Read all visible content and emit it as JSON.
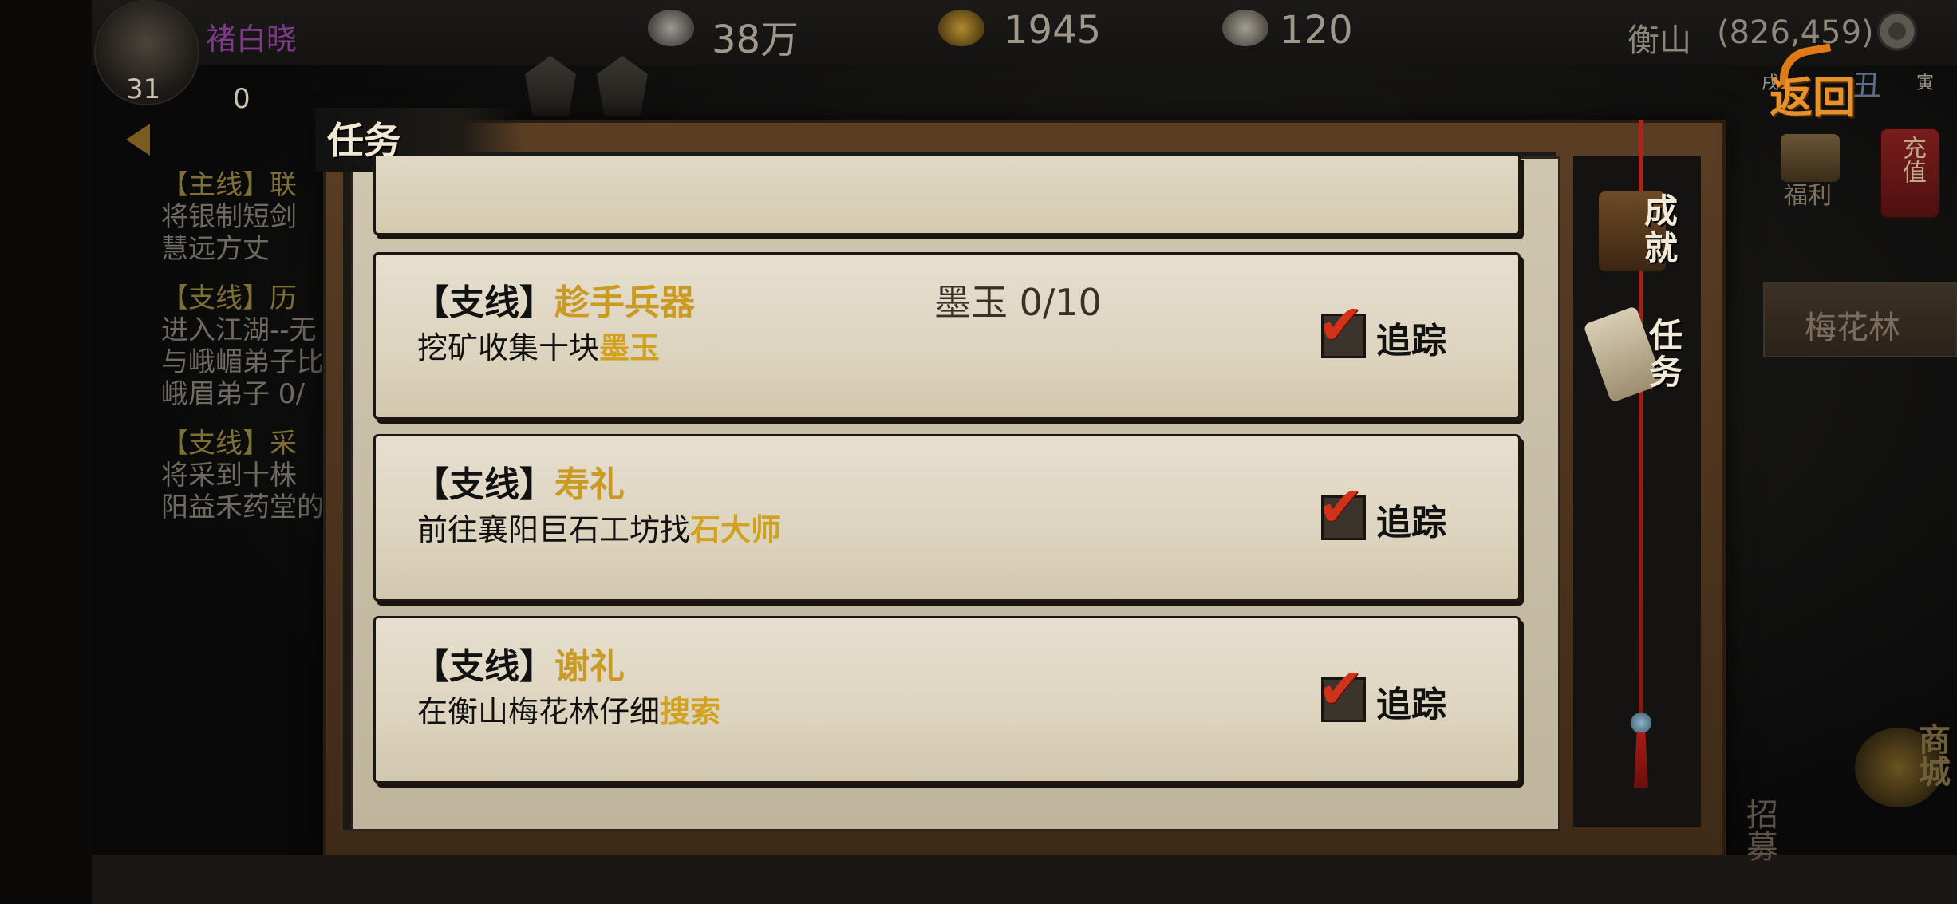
{
  "player": {
    "name": "褚白晓",
    "level": "31",
    "secondary_value": "0"
  },
  "currency": {
    "silver": "38万",
    "gold": "1945",
    "bun": "120"
  },
  "location": {
    "name": "衡山",
    "coords": "(826,459)"
  },
  "time_marks": {
    "left": "戌",
    "mid": "丑",
    "right": "寅"
  },
  "buttons": {
    "back": "返回",
    "welfare": "福利",
    "recharge": "充值",
    "plum_forest": "梅花林",
    "shop": "商城",
    "recruit": "招募"
  },
  "background_quests": [
    {
      "tag": "【主线】",
      "title": "联",
      "lines": [
        "将银制短剑",
        "慧远方丈"
      ]
    },
    {
      "tag": "【支线】",
      "title": "历",
      "lines": [
        "进入江湖--无",
        "与峨嵋弟子比",
        "峨眉弟子 0/"
      ]
    },
    {
      "tag": "【支线】",
      "title": "采",
      "lines": [
        "将采到十株",
        "阳益禾药堂的"
      ]
    }
  ],
  "panel": {
    "title": "任务",
    "tabs": [
      {
        "label": "成就",
        "icon": "book-icon"
      },
      {
        "label": "任务",
        "icon": "scroll-icon"
      }
    ]
  },
  "quests": [
    {
      "tag": "【支线】",
      "name": "趁手兵器",
      "desc_prefix": "挖矿收集十块",
      "desc_highlight": "墨玉",
      "progress": "墨玉  0/10",
      "track_label": "追踪",
      "tracked": true
    },
    {
      "tag": "【支线】",
      "name": "寿礼",
      "desc_prefix": "前往襄阳巨石工坊找",
      "desc_highlight": "石大师",
      "progress": "",
      "track_label": "追踪",
      "tracked": true
    },
    {
      "tag": "【支线】",
      "name": "谢礼",
      "desc_prefix": "在衡山梅花林仔细",
      "desc_highlight": "搜索",
      "progress": "",
      "track_label": "追踪",
      "tracked": true
    }
  ],
  "colors": {
    "highlight": "#d1a120",
    "check": "#d3321a",
    "back_button": "#e8912b"
  }
}
